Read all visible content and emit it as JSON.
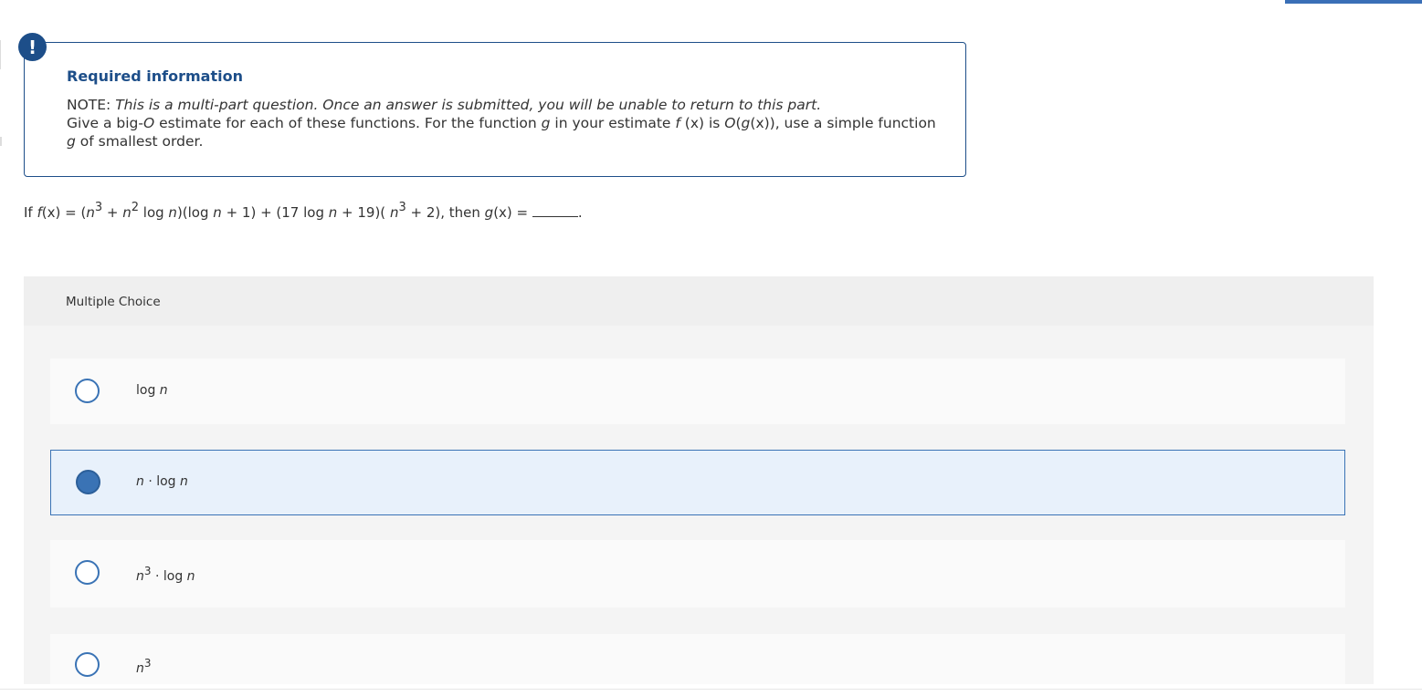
{
  "alert": {
    "icon": "exclamation-icon",
    "glyph": "!"
  },
  "info": {
    "title": "Required information",
    "note_prefix": "NOTE: ",
    "note_italic": "This is a multi-part question. Once an answer is submitted, you will be unable to return to this part.",
    "line2_a": "Give a big-",
    "line2_O": "O",
    "line2_b": " estimate for each of these functions. For the function ",
    "line2_g": "g",
    "line2_c": " in your estimate ",
    "line2_fx": "f",
    "line2_d": " (x) is ",
    "line2_O2": "O",
    "line2_e": "(",
    "line2_gx": "g",
    "line2_f": "(x)), use a simple function",
    "line3_g": "g",
    "line3_rest": " of smallest order."
  },
  "question": {
    "p1": "If ",
    "f": "f",
    "p2": "(x) = (",
    "n1": "n",
    "e3a": "3",
    "p3": " + ",
    "n2": "n",
    "e2": "2",
    "p4": " log ",
    "n3": "n",
    "p5": ")(log ",
    "n4": "n",
    "p6": " + 1) + (17 log ",
    "n5": "n",
    "p7": " + 19)( ",
    "n6": "n",
    "e3b": "3",
    "p8": " + 2), then ",
    "g": "g",
    "p9": "(x) = ",
    "p10": "."
  },
  "multiple_choice": {
    "label": "Multiple Choice",
    "options": [
      {
        "text": "log",
        "var": "n",
        "selected": false
      },
      {
        "var_a": "n",
        "text": " · log ",
        "var_b": "n",
        "selected": true
      },
      {
        "var_a": "n",
        "exp": "3",
        "text": " · log ",
        "var_b": "n",
        "selected": false
      },
      {
        "var_a": "n",
        "exp": "3",
        "selected": false
      }
    ]
  },
  "colors": {
    "primary": "#1d4e89",
    "accent": "#3a73b5",
    "selected_bg": "#e8f1fb"
  }
}
